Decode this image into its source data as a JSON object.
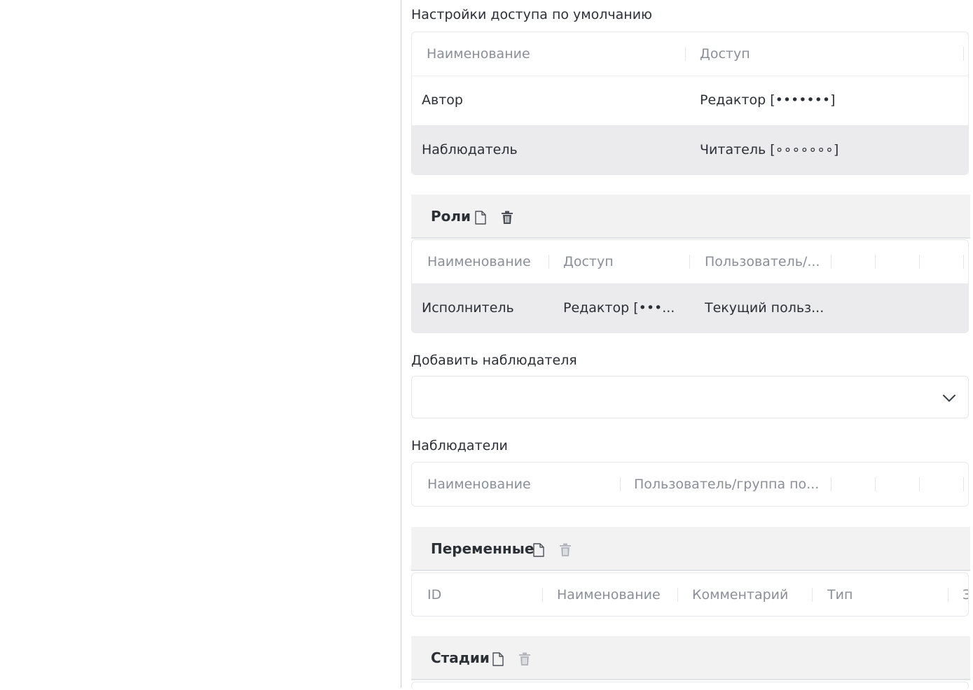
{
  "default_access": {
    "title": "Настройки доступа по умолчанию",
    "columns": [
      "Наименование",
      "Доступ"
    ],
    "rows": [
      {
        "name": "Автор",
        "access": "Редактор [•••••••]"
      },
      {
        "name": "Наблюдатель",
        "access": "Читатель [∘∘∘∘∘∘∘]"
      }
    ]
  },
  "roles": {
    "title": "Роли",
    "columns": [
      "Наименование",
      "Доступ",
      "Пользователь/..."
    ],
    "rows": [
      {
        "name": "Исполнитель",
        "access": "Редактор [•••...",
        "user": "Текущий польз..."
      }
    ]
  },
  "add_observer": {
    "label": "Добавить наблюдателя",
    "value": ""
  },
  "observers": {
    "label": "Наблюдатели",
    "columns": [
      "Наименование",
      "Пользователь/группа по..."
    ]
  },
  "variables": {
    "title": "Переменные",
    "columns": [
      "ID",
      "Наименование",
      "Комментарий",
      "Тип",
      "З"
    ]
  },
  "stages": {
    "title": "Стадии"
  },
  "icons": {
    "add": "new-document-icon",
    "delete": "trash-icon",
    "dropdown": "chevron-down-icon"
  },
  "colors": {
    "selected_row": "#ebebed",
    "group_header": "#f2f2f3",
    "icon_active": "#4a4f57",
    "icon_disabled": "#b4b8be"
  }
}
